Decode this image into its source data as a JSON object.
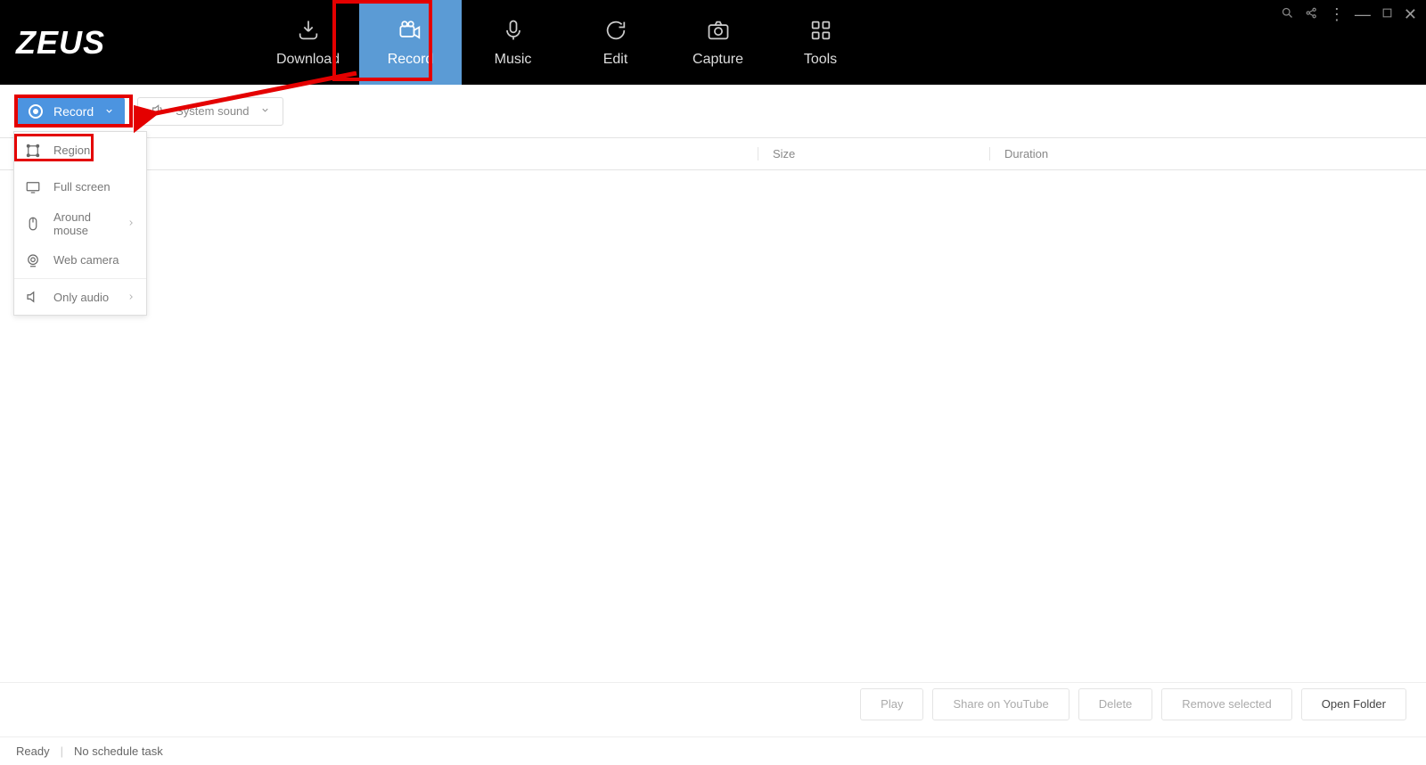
{
  "app": {
    "logo": "ZEUS"
  },
  "nav": {
    "items": [
      {
        "label": "Download"
      },
      {
        "label": "Record"
      },
      {
        "label": "Music"
      },
      {
        "label": "Edit"
      },
      {
        "label": "Capture"
      },
      {
        "label": "Tools"
      }
    ]
  },
  "toolbar": {
    "record_label": "Record",
    "sound_label": "System sound"
  },
  "dropdown": {
    "items": [
      {
        "label": "Region"
      },
      {
        "label": "Full screen"
      },
      {
        "label": "Around mouse"
      },
      {
        "label": "Web camera"
      },
      {
        "label": "Only audio"
      }
    ]
  },
  "columns": {
    "size": "Size",
    "duration": "Duration"
  },
  "actions": {
    "play": "Play",
    "share": "Share on YouTube",
    "delete": "Delete",
    "remove": "Remove selected",
    "open": "Open Folder"
  },
  "status": {
    "ready": "Ready",
    "schedule": "No schedule task"
  }
}
